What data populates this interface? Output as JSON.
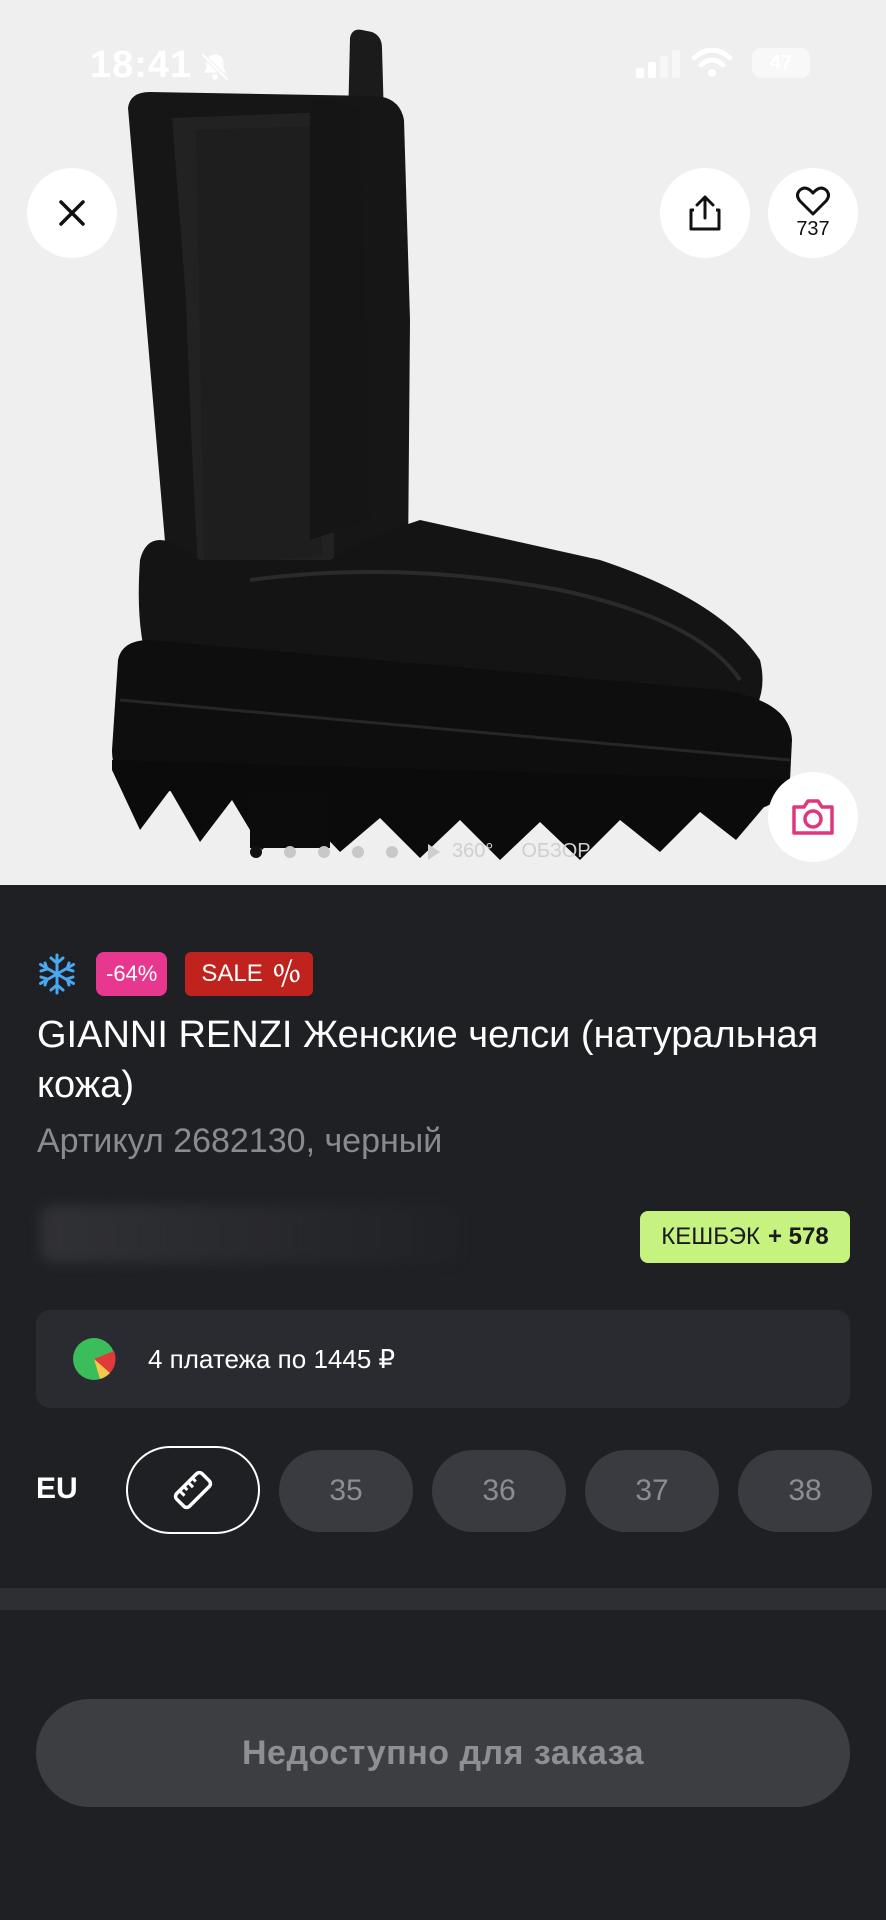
{
  "status_bar": {
    "time": "18:41",
    "battery": "47"
  },
  "gallery": {
    "favorites_count": "737",
    "view360_deg": "360°",
    "view360_label": "ОБЗОР"
  },
  "badges": {
    "discount": "-64%",
    "sale": "SALE",
    "sale_symbol": "%"
  },
  "product": {
    "title": "GIANNI RENZI Женские челси (натуральная кожа)",
    "article": "Артикул 2682130, черный"
  },
  "cashback": {
    "label": "КЕШБЭК",
    "value": "+ 578"
  },
  "installments": {
    "text": "4 платежа по 1445 ₽"
  },
  "sizes": {
    "system": "EU",
    "options": [
      "35",
      "36",
      "37",
      "38"
    ]
  },
  "order_button": {
    "label": "Недоступно для заказа"
  },
  "colors": {
    "discount": "#e8378f",
    "sale": "#c0231d",
    "cashback": "#c6f37f",
    "camera_icon": "#e0367e",
    "snow_icon": "#4aa8f0"
  }
}
